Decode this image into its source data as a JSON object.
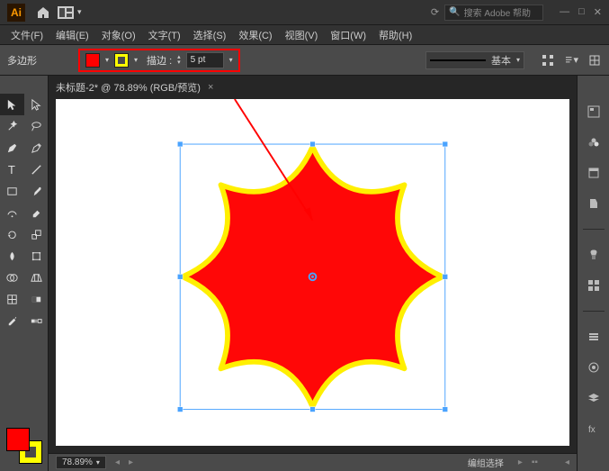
{
  "app": {
    "logo": "Ai"
  },
  "search": {
    "placeholder": "搜索 Adobe 帮助"
  },
  "menus": {
    "file": "文件(F)",
    "edit": "编辑(E)",
    "object": "对象(O)",
    "type": "文字(T)",
    "select": "选择(S)",
    "effect": "效果(C)",
    "view": "视图(V)",
    "window": "窗口(W)",
    "help": "帮助(H)"
  },
  "control": {
    "shape_label": "多边形",
    "stroke_label": "描边 :",
    "stroke_value": "5 pt",
    "style_label": "基本"
  },
  "tab": {
    "title": "未标题-2* @ 78.89% (RGB/预览)"
  },
  "status": {
    "zoom": "78.89%",
    "selection": "编组选择"
  },
  "colors": {
    "fill": "#ff0000",
    "stroke": "#ffff00"
  }
}
